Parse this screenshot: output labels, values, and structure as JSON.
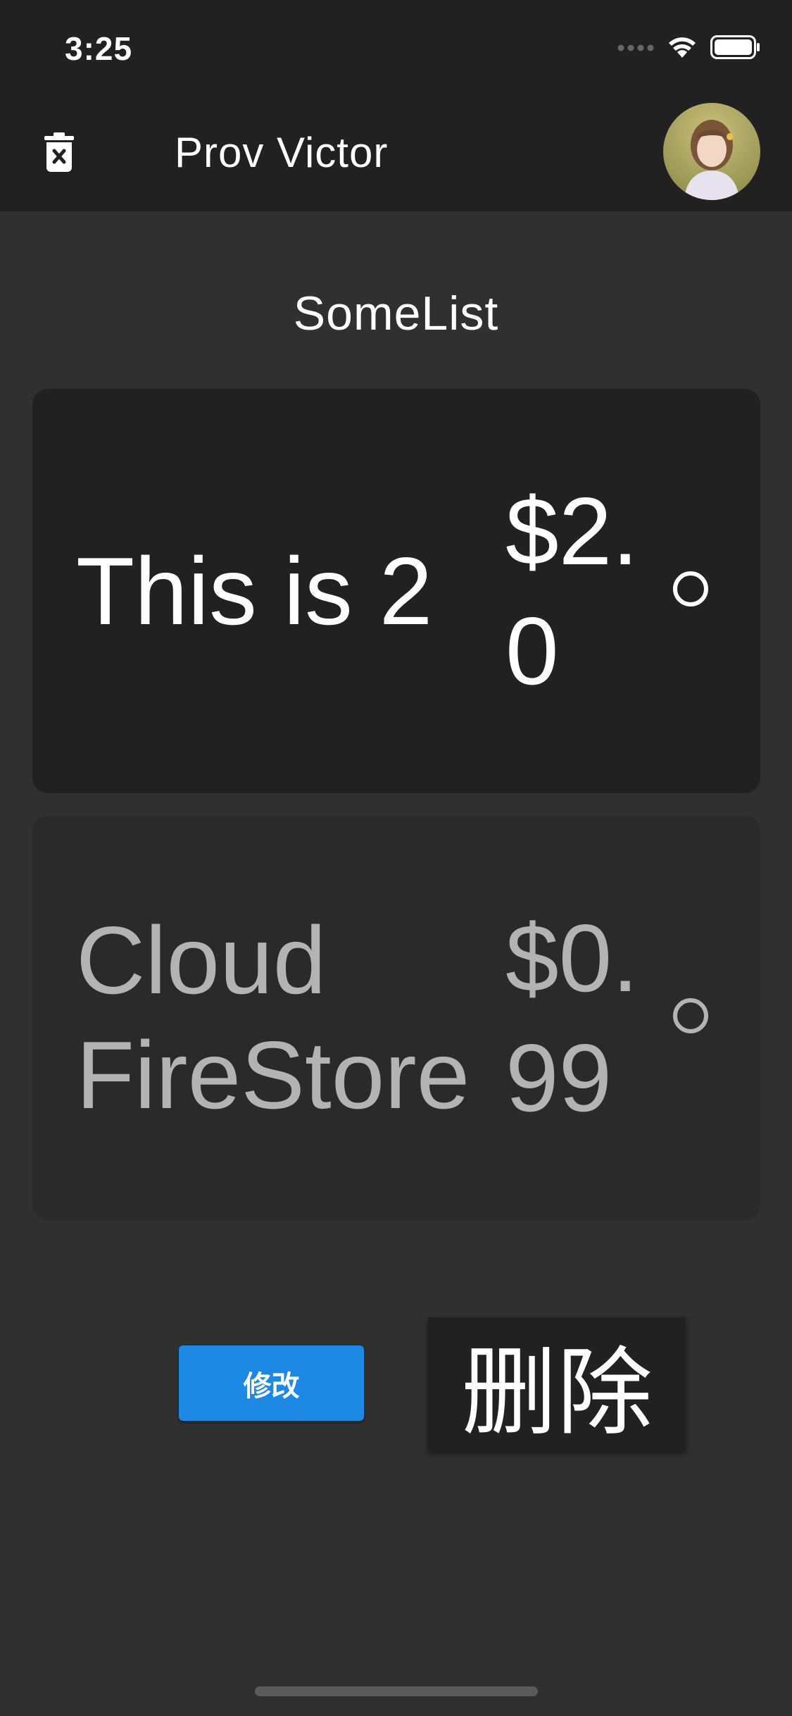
{
  "status_bar": {
    "time": "3:25"
  },
  "appbar": {
    "title": "Prov Victor"
  },
  "list": {
    "title": "SomeList",
    "items": [
      {
        "name": "This is 2",
        "price": "$2.0",
        "selected": true
      },
      {
        "name": "Cloud FireStore",
        "price": "$0.99",
        "selected": false
      }
    ]
  },
  "actions": {
    "edit_label": "修改",
    "delete_label": "删除"
  },
  "colors": {
    "background": "#303030",
    "appbar": "#212121",
    "card_selected": "#212121",
    "card_default": "#2a2a2a",
    "accent": "#1e88e5"
  },
  "icons": {
    "appbar_left": "delete-forever-icon",
    "status": [
      "cellular-signal-icon",
      "wifi-icon",
      "battery-icon"
    ]
  }
}
